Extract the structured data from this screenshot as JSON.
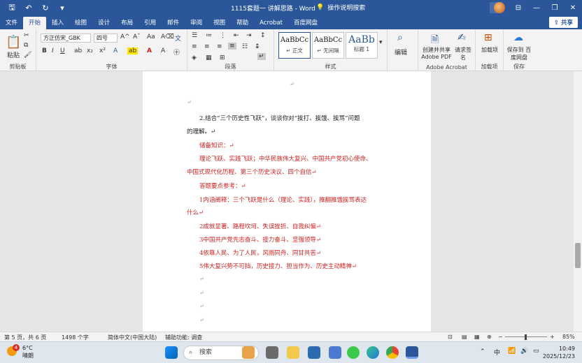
{
  "window": {
    "title": "1115套题一 讲解思路 - Word",
    "search_hint": "操作说明搜索"
  },
  "tabs": [
    "文件",
    "开始",
    "插入",
    "绘图",
    "设计",
    "布局",
    "引用",
    "邮件",
    "审阅",
    "视图",
    "帮助",
    "Acrobat",
    "百度网盘"
  ],
  "share_label": "共享",
  "ribbon": {
    "groups": {
      "clipboard": "剪贴板",
      "font": "字体",
      "paragraph": "段落",
      "styles": "样式",
      "adobe": "Adobe Acrobat",
      "addins": "加载项",
      "save": "保存"
    },
    "paste_label": "粘贴",
    "font_name": "方正仿宋_GBK",
    "font_size": "四号",
    "styles": [
      {
        "preview": "AaBbCc",
        "name": "↵ 正文"
      },
      {
        "preview": "AaBbCc",
        "name": "↵ 无间隔"
      },
      {
        "preview": "AaBb",
        "name": "标题 1"
      }
    ],
    "edit_label": "编辑",
    "adobe_create": "创建并共享 Adobe PDF",
    "adobe_request": "请求签名",
    "addin_label": "加载项",
    "baidu_save": "保存到 百度网盘"
  },
  "document": {
    "top_mark": "↵",
    "lines": [
      {
        "text": "↵",
        "color": "mark"
      },
      {
        "text": "2.结合“三个历史性飞跃”，谈谈你对“挨打、挨饿、挨骂”问题",
        "color": "blk"
      },
      {
        "text": "的理解。↵",
        "color": "blk"
      },
      {
        "text": "储备知识：↵",
        "color": "red"
      },
      {
        "text": "理论飞跃、实践飞跃；中华民族伟大复兴、中国共产党初心使命、",
        "color": "red"
      },
      {
        "text": "中国式现代化历程、第三个历史决议、四个自信↵",
        "color": "red"
      },
      {
        "text": "答题要点参考：↵",
        "color": "red"
      },
      {
        "text": "1内涵阐释：三个飞跃是什么（理论、实践），推翻推饿挨骂表达",
        "color": "red"
      },
      {
        "text": "什么↵",
        "color": "red"
      },
      {
        "text": "2成就显著、路程坎坷、失误挫折、自我纠偏↵",
        "color": "red"
      },
      {
        "text": "3中国共产党先志奋斗、接力奋斗、坚强领导↵",
        "color": "red"
      },
      {
        "text": "4依靠人民、为了人民，风雨同舟、同甘共苦↵",
        "color": "red"
      },
      {
        "text": "5伟大复兴势不可挡，历史接力、担当作为、历史主动精神↵",
        "color": "red"
      },
      {
        "text": "↵",
        "color": "mark"
      },
      {
        "text": "↵",
        "color": "mark"
      },
      {
        "text": "↵",
        "color": "mark"
      },
      {
        "text": "↵",
        "color": "mark"
      }
    ]
  },
  "status": {
    "page": "第 5 页，共 6 页",
    "words": "1498 个字",
    "lang": "简体中文(中国大陆)",
    "access": "辅助功能: 调查",
    "zoom": "85%"
  },
  "taskbar": {
    "temp": "6°C",
    "weather": "晴朗",
    "search": "搜索",
    "ime": "中",
    "time": "10:49",
    "date": "2025/12/23",
    "badge": "4"
  }
}
